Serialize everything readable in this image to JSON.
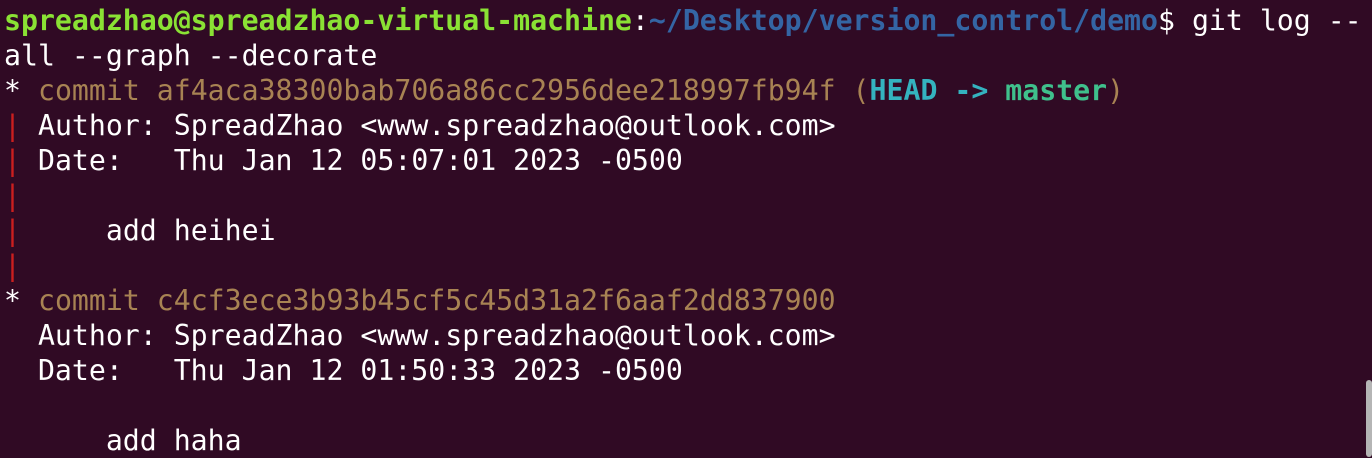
{
  "prompt": {
    "user_host": "spreadzhao@spreadzhao-virtual-machine",
    "separator": ":",
    "path": "~/Desktop/version_control/demo",
    "symbol": "$",
    "command_line1": " git log --",
    "command_line2": "all --graph --decorate"
  },
  "graph": {
    "star": "*",
    "bar": "|"
  },
  "commits": [
    {
      "commit_text": "commit af4aca38300bab706a86cc2956dee218997fb94f",
      "ref_open": " (",
      "head": "HEAD -> ",
      "branch": "master",
      "ref_close": ")",
      "author": "Author: SpreadZhao <www.spreadzhao@outlook.com>",
      "date": "Date:   Thu Jan 12 05:07:01 2023 -0500",
      "message": "    add heihei"
    },
    {
      "commit_text": "commit c4cf3ece3b93b45cf5c45d31a2f6aaf2dd837900",
      "author": "Author: SpreadZhao <www.spreadzhao@outlook.com>",
      "date": "Date:   Thu Jan 12 01:50:33 2023 -0500",
      "message": "    add haha"
    }
  ],
  "colors": {
    "background": "#300a24",
    "user_host": "#8ae234",
    "path": "#3465a4",
    "commit_hash": "#a88353",
    "head": "#34b3bf",
    "branch": "#3fc08c",
    "graph_bar": "#cc1f1f"
  }
}
